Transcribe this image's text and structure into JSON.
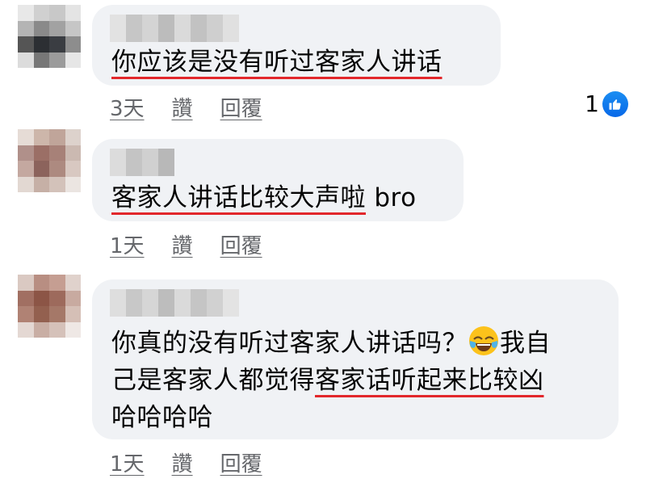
{
  "comments": [
    {
      "lines": [
        "你应该是没有听过客家人讲话"
      ],
      "time": "3天",
      "like_label": "讚",
      "reply_label": "回覆",
      "reaction_count": "1"
    },
    {
      "text_part1": "客家人讲话比较大声啦",
      "text_part2": " bro",
      "time": "1天",
      "like_label": "讚",
      "reply_label": "回覆"
    },
    {
      "line1_a": "你真的没有听过客家人讲话吗？",
      "line1_b": "我自",
      "line2_a": "己是客家人都觉得",
      "line2_b": "客家话听起来比较凶",
      "line3": "哈哈哈哈",
      "emoji_name": "tears-of-joy-emoji",
      "time": "1天",
      "like_label": "讚",
      "reply_label": "回覆"
    }
  ],
  "colors": {
    "bubble": "#f0f2f5",
    "underline": "#e2272b",
    "meta_text": "#65676b",
    "like_blue": "#1877f2"
  }
}
